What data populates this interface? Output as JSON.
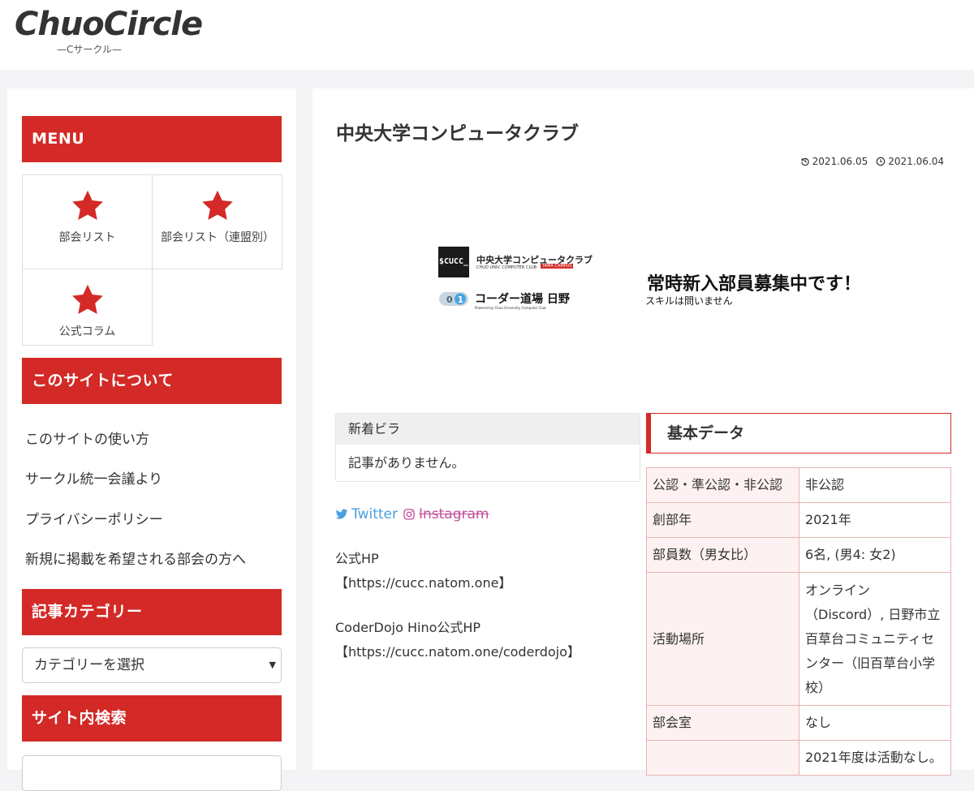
{
  "header": {
    "logo_main": "ChuoCircle",
    "logo_sub": "—Cサークル—"
  },
  "sidebar": {
    "menu_title": "MENU",
    "menu_items": [
      {
        "label": "部会リスト",
        "icon": "star-icon"
      },
      {
        "label": "部会リスト（連盟別）",
        "icon": "star-icon"
      },
      {
        "label": "公式コラム",
        "icon": "star-icon"
      }
    ],
    "about_title": "このサイトについて",
    "about_links": [
      "このサイトの使い方",
      "サークル統一会議より",
      "プライバシーポリシー",
      "新規に掲載を希望される部会の方へ"
    ],
    "category_title": "記事カテゴリー",
    "category_select": "カテゴリーを選択",
    "search_title": "サイト内検索"
  },
  "post": {
    "title": "中央大学コンピュータクラブ",
    "updated_date": "2021.06.05",
    "published_date": "2021.06.04"
  },
  "banner": {
    "cucc_box": "$CUCC_",
    "cucc_name": "中央大学コンピュータクラブ",
    "cucc_en": "CHUO UNIV. COMPUTER CLUB",
    "cucc_tama": "TAMA CAMPUS",
    "dojo_name": "コーダー道場 日野",
    "dojo_sub": "Powered by Chuo University Computer Club",
    "recruit_main": "常時新入部員募集中です！",
    "recruit_sub": "スキルは問いません"
  },
  "news": {
    "title": "新着ビラ",
    "empty": "記事がありません。"
  },
  "social": {
    "twitter": "Twitter",
    "instagram": "Instagram"
  },
  "links": {
    "hp_label": "公式HP",
    "hp_url": "【https://cucc.natom.one】",
    "dojo_label": "CoderDojo Hino公式HP",
    "dojo_url": "【https://cucc.natom.one/coderdojo】"
  },
  "data": {
    "heading": "基本データ",
    "rows": [
      {
        "key": "公認・準公認・非公認",
        "value": "非公認"
      },
      {
        "key": "創部年",
        "value": "2021年"
      },
      {
        "key": "部員数（男女比）",
        "value": "6名, (男4: 女2)"
      },
      {
        "key": "活動場所",
        "value": "オンライン（Discord）, 日野市立百草台コミュニティセンター（旧百草台小学校）"
      },
      {
        "key": "部会室",
        "value": "なし"
      },
      {
        "key": "",
        "value": "2021年度は活動なし。"
      }
    ]
  },
  "colors": {
    "accent": "#d32a27",
    "twitter": "#4a9fe0",
    "instagram": "#c24f9a"
  }
}
